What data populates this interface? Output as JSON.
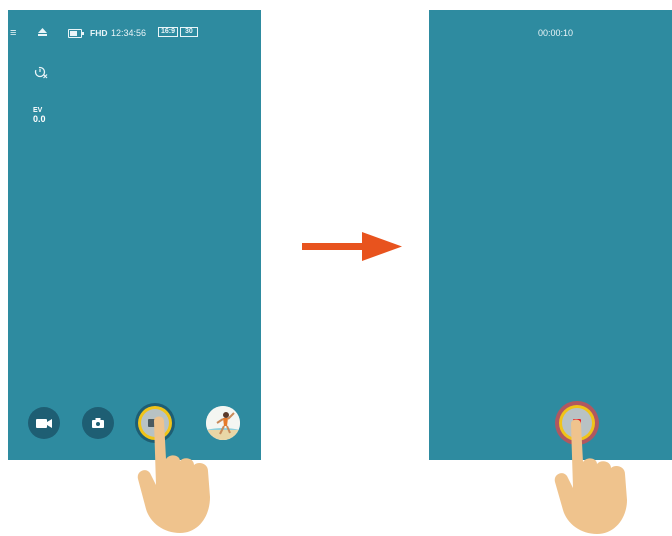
{
  "left_screen": {
    "status_bar": {
      "menu_icon": "menu-icon",
      "eject_icon": "eject-icon",
      "battery_icon": "battery-icon",
      "resolution": "FHD",
      "time": "12:34:56",
      "aspect_ratio": "16:9",
      "frame_rate": "30"
    },
    "self_timer_icon": "timer-off-icon",
    "ev": {
      "label": "EV",
      "value": "0.0"
    },
    "bottom_bar": [
      {
        "name": "video-mode-button",
        "icon": "video-camera-icon"
      },
      {
        "name": "photo-mode-button",
        "icon": "camera-icon"
      },
      {
        "name": "record-button",
        "icon": "video-camera-icon"
      },
      {
        "name": "gallery-thumbnail",
        "icon": "beach-photo-thumbnail"
      }
    ]
  },
  "right_screen": {
    "recording_time": "00:00:10",
    "stop_button_icon": "stop-icon"
  },
  "colors": {
    "screen_background": "#2e8ba0",
    "button_background": "#1e5e73",
    "record_ring": "#f0c419",
    "stop_red": "#e2202a",
    "arrow": "#e8531e",
    "hand_skin": "#efc38d"
  }
}
